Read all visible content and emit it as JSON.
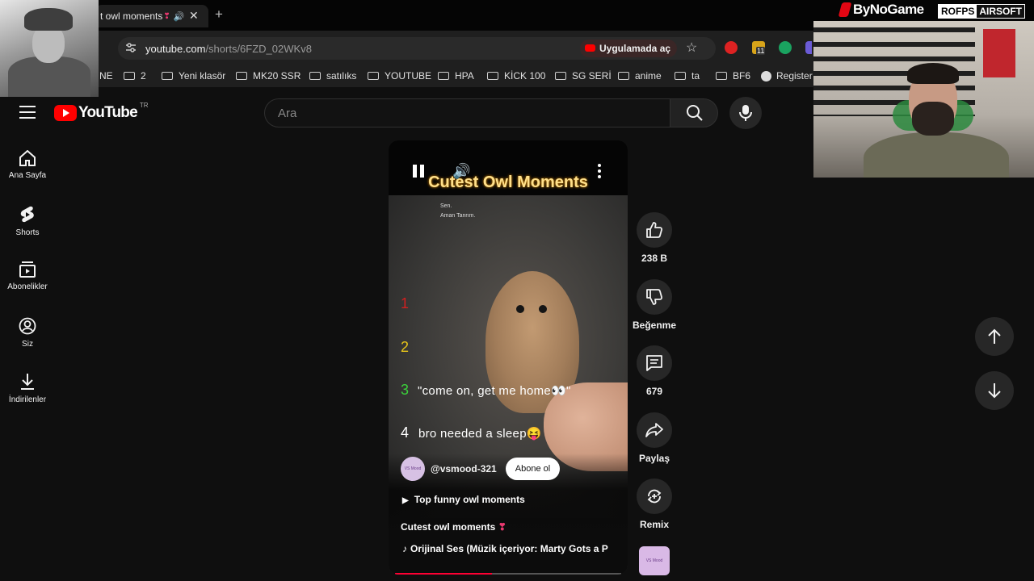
{
  "browser": {
    "tab_title": "t owl moments",
    "tab_heart": "❣",
    "url_host": "youtube.com",
    "url_path": "/shorts/6FZD_02WKv8",
    "open_in_app": "Uygulamada aç",
    "bookmarks": [
      {
        "label": "NE",
        "folder": false
      },
      {
        "label": "2",
        "folder": true
      },
      {
        "label": "Yeni klasör",
        "folder": true
      },
      {
        "label": "MK20 SSR",
        "folder": true
      },
      {
        "label": "satılıks",
        "folder": true
      },
      {
        "label": "YOUTUBE",
        "folder": true
      },
      {
        "label": "HPA",
        "folder": true
      },
      {
        "label": "KİCK 100",
        "folder": true
      },
      {
        "label": "SG SERİ",
        "folder": true
      },
      {
        "label": "anime",
        "folder": true
      },
      {
        "label": "ta",
        "folder": true
      },
      {
        "label": "BF6",
        "folder": true
      },
      {
        "label": "Register",
        "folder": false
      }
    ],
    "extension_badge": "11"
  },
  "youtube": {
    "logo_text": "YouTube",
    "country": "TR",
    "search_placeholder": "Ara"
  },
  "sidebar": [
    {
      "label": "Ana Sayfa",
      "icon": "home-icon"
    },
    {
      "label": "Shorts",
      "icon": "shorts-icon"
    },
    {
      "label": "Abonelikler",
      "icon": "subscriptions-icon"
    },
    {
      "label": "Siz",
      "icon": "account-icon"
    },
    {
      "label": "İndirilenler",
      "icon": "download-icon"
    }
  ],
  "short": {
    "overlay_title": "Cutest Owl Moments",
    "small_caption_1": "Sen.",
    "small_caption_2": "Aman Tanrım.",
    "list": [
      {
        "n": "1",
        "text": "",
        "color": "#d21f1f"
      },
      {
        "n": "2",
        "text": "",
        "color": "#e7c41a"
      },
      {
        "n": "3",
        "text": "\"come on, get me home👀\"",
        "color": "#3bd03b"
      },
      {
        "n": "4",
        "text": "bro needed a sleep😝",
        "color": "#ffffff"
      }
    ],
    "channel": "@vsmood-321",
    "channel_avatar_text": "VS Mood",
    "subscribe": "Abone ol",
    "playlist": "Top funny owl moments",
    "title": "Cutest owl moments",
    "title_heart": "❣",
    "audio": "Orijinal Ses (Müzik içeriyor: Marty Gots a P",
    "progress": 0.43
  },
  "actions": {
    "likes": "238 B",
    "dislike": "Beğenme",
    "comments": "679",
    "share": "Paylaş",
    "remix": "Remix"
  },
  "stream": {
    "brand": "ByNoGame",
    "sponsor_a": "ROFPS",
    "sponsor_b": "AIRSOFT"
  },
  "colors": {
    "accent_red": "#ff0000",
    "progress": "#ff0033",
    "overlay_title": "#ffe08a"
  }
}
